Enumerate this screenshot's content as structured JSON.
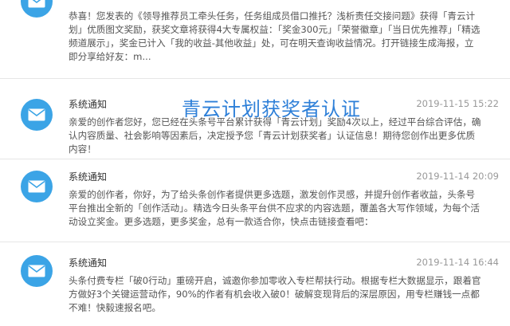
{
  "overlay_title": "青云计划获奖者认证",
  "notifications": [
    {
      "title": "",
      "time": "",
      "body": "恭喜！您发表的《领导推荐员工牵头任务，任务组成员借口推托？浅析责任交接问题》获得「青云计划」优质图文奖励，获奖文章将获得4大专属权益：「奖金300元」「荣誉徽章」「当日优先推荐」「精选频道展示」，奖金已计入「我的收益-其他收益」处，可在明天查询收益情况。打开链接生成海报，立即分享给好友：m...",
      "icon": "mail-icon"
    },
    {
      "title": "系统通知",
      "time": "2019-11-15 15:22",
      "body": "亲爱的创作者您好，您已经在头条号平台累计获得「青云计划」奖励4次以上，经过平台综合评估，确认内容质量、社会影响等因素后，决定授予您「青云计划获奖者」认证信息！期待您创作出更多优质内容！",
      "icon": "mail-icon"
    },
    {
      "title": "系统通知",
      "time": "2019-11-14 20:09",
      "body": "亲爱的创作者，你好，为了给头条创作者提供更多选题，激发创作灵感，并提升创作者收益，头条号平台推出全新的「创作活动」。精选今日头条平台供不应求的内容选题，覆盖各大写作领域，为每个活动设立奖金。更多选题，更多奖金，总有一款适合你，快点击链接查看吧：",
      "icon": "mail-icon"
    },
    {
      "title": "系统通知",
      "time": "2019-11-14 16:44",
      "body": "头条付费专栏「破0行动」重磅开启，诚邀你参加零收入专栏帮扶行动。根据专栏大数据显示，跟着官方做好3个关键运营动作，90%的作者有机会收入破0！破解变现背后的深层原因，用专栏赚钱一点都不难！快毅速报名吧。",
      "icon": "mail-icon"
    }
  ]
}
